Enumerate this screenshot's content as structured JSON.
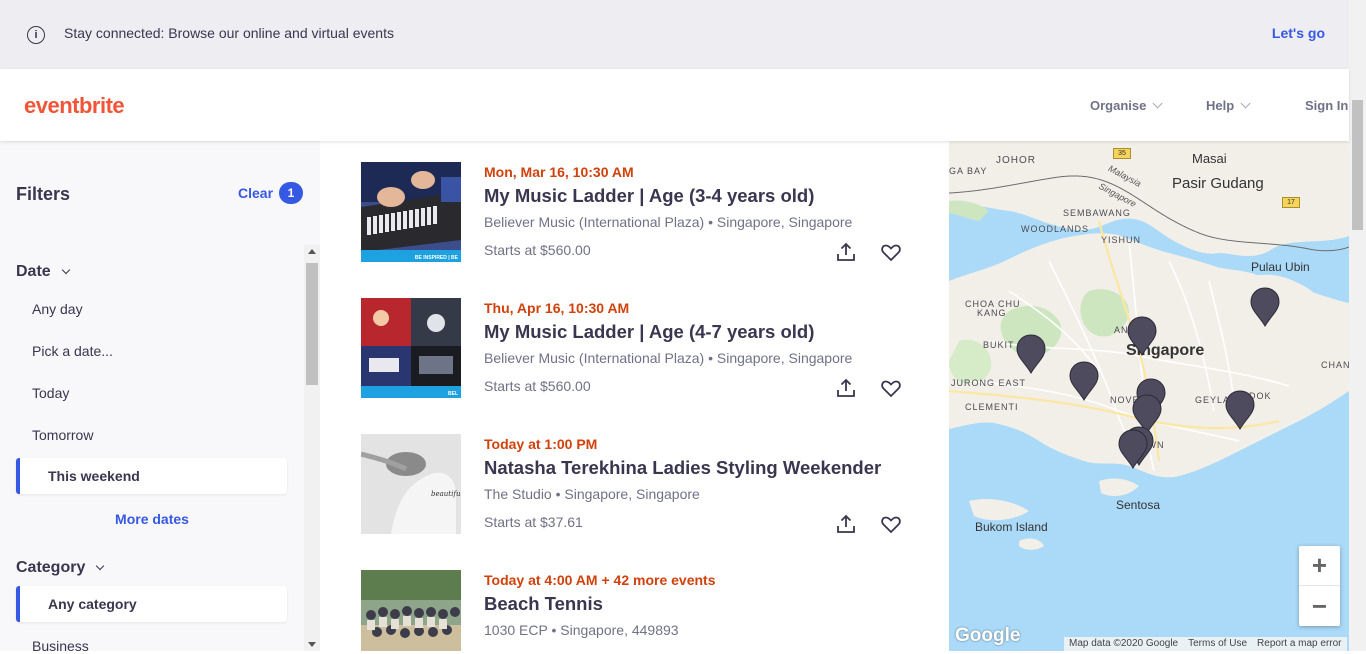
{
  "banner": {
    "text": "Stay connected: Browse our online and virtual events",
    "link": "Let's go"
  },
  "header": {
    "logo": "eventbrite",
    "nav": [
      {
        "label": "Organise"
      },
      {
        "label": "Help"
      },
      {
        "label": "Sign In"
      }
    ]
  },
  "sidebar": {
    "title": "Filters",
    "clear_label": "Clear",
    "clear_count": "1",
    "date": {
      "heading": "Date",
      "options": [
        "Any day",
        "Pick a date...",
        "Today",
        "Tomorrow",
        "This weekend"
      ],
      "selected": "This weekend",
      "more": "More dates"
    },
    "category": {
      "heading": "Category",
      "selected": "Any category",
      "options": [
        "Business"
      ]
    }
  },
  "events": [
    {
      "date": "Mon, Mar 16, 10:30 AM",
      "title": "My Music Ladder | Age (3-4 years old)",
      "venue": "Believer Music (International Plaza) • Singapore, Singapore",
      "price": "Starts at $560.00",
      "thumb_caption": "BE INSPIRED | BE"
    },
    {
      "date": "Thu, Apr 16, 10:30 AM",
      "title": "My Music Ladder | Age (4-7 years old)",
      "venue": "Believer Music (International Plaza) • Singapore, Singapore",
      "price": "Starts at $560.00",
      "thumb_caption": "BEL"
    },
    {
      "date": "Today at 1:00 PM",
      "title": "Natasha Terekhina Ladies Styling Weekender",
      "venue": "The Studio • Singapore, Singapore",
      "price": "Starts at $37.61",
      "thumb_caption": "beautiful Souls"
    },
    {
      "date": "Today at 4:00 AM + 42 more events",
      "title": "Beach Tennis",
      "venue": "1030 ECP • Singapore, 449893",
      "price": "",
      "thumb_caption": ""
    }
  ],
  "map": {
    "labels": [
      {
        "text": "JOHOR",
        "kind": "small"
      },
      {
        "text": "Masai",
        "kind": "town"
      },
      {
        "text": "Pasir Gudang",
        "kind": "town-lg"
      },
      {
        "text": "GA BAY",
        "kind": "small"
      },
      {
        "text": "Malaysia",
        "kind": "border"
      },
      {
        "text": "Singapore",
        "kind": "border"
      },
      {
        "text": "SEMBAWANG",
        "kind": "small"
      },
      {
        "text": "WOODLANDS",
        "kind": "small"
      },
      {
        "text": "YISHUN",
        "kind": "small"
      },
      {
        "text": "Pulau Ubin",
        "kind": "town"
      },
      {
        "text": "CHOA CHU",
        "kind": "small"
      },
      {
        "text": "KANG",
        "kind": "small"
      },
      {
        "text": "BUKIT",
        "kind": "small"
      },
      {
        "text": "Singapore",
        "kind": "city"
      },
      {
        "text": "ANG MO",
        "kind": "small"
      },
      {
        "text": "JURONG EAST",
        "kind": "small"
      },
      {
        "text": "CLEMENTI",
        "kind": "small"
      },
      {
        "text": "NOVE",
        "kind": "small"
      },
      {
        "text": "GEYLANG",
        "kind": "small"
      },
      {
        "text": "DOK",
        "kind": "small"
      },
      {
        "text": "CHAN",
        "kind": "small"
      },
      {
        "text": "DOWN",
        "kind": "small"
      },
      {
        "text": "Sentosa",
        "kind": "town"
      },
      {
        "text": "Bukom Island",
        "kind": "town"
      }
    ],
    "road_badges": [
      "35",
      "17"
    ],
    "zoom_in": "+",
    "zoom_out": "−",
    "attribution": "Google",
    "footer": [
      "Map data ©2020 Google",
      "Terms of Use",
      "Report a map error"
    ]
  },
  "colors": {
    "brand": "#f05537",
    "accent": "#3659e3",
    "date_red": "#d1410c",
    "text": "#39364f",
    "muted": "#6f7287",
    "water": "#aadaf8",
    "pin": "#4d4b5d"
  }
}
